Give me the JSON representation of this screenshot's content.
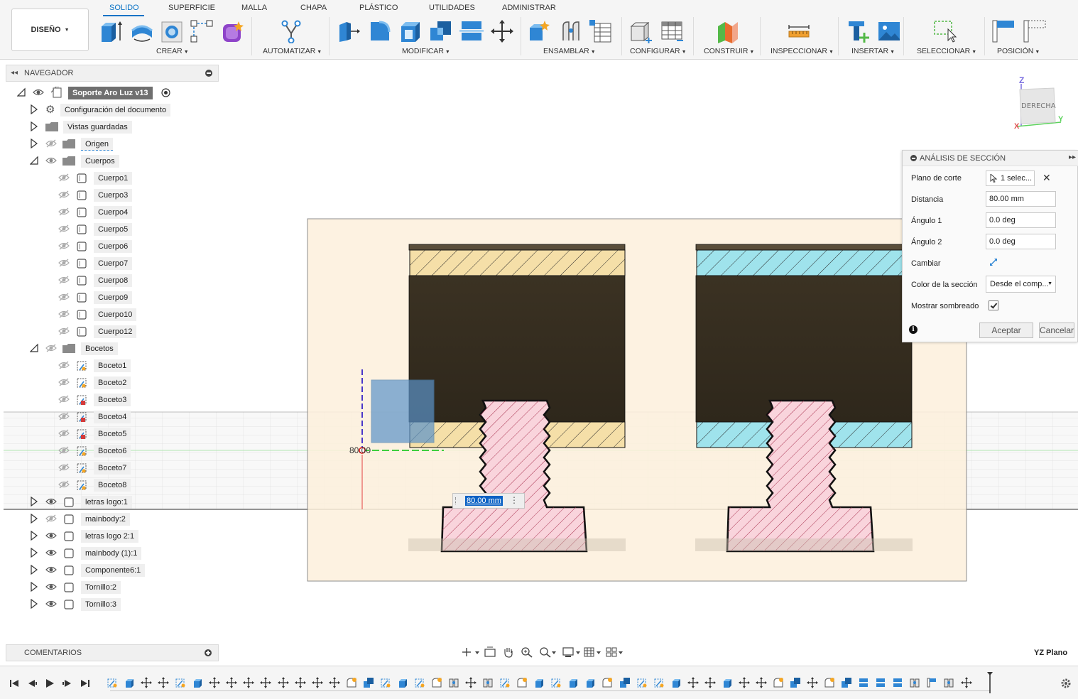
{
  "toolbar": {
    "workspace": "DISEÑO",
    "tabs": [
      "SOLIDO",
      "SUPERFICIE",
      "MALLA",
      "CHAPA",
      "PLÁSTICO",
      "UTILIDADES",
      "ADMINISTRAR"
    ],
    "active_tab": "SOLIDO",
    "groups": {
      "crear": "CREAR",
      "automatizar": "AUTOMATIZAR",
      "modificar": "MODIFICAR",
      "ensamblar": "ENSAMBLAR",
      "configurar": "CONFIGURAR",
      "construir": "CONSTRUIR",
      "inspeccionar": "INSPECCIONAR",
      "insertar": "INSERTAR",
      "seleccionar": "SELECCIONAR",
      "posicion": "POSICIÓN"
    }
  },
  "navigator": {
    "title": "NAVEGADOR",
    "root": "Soporte Aro Luz v13",
    "doc_settings": "Configuración del documento",
    "saved_views": "Vistas guardadas",
    "origin": "Origen",
    "bodies_folder": "Cuerpos",
    "bodies": [
      "Cuerpo1",
      "Cuerpo3",
      "Cuerpo4",
      "Cuerpo5",
      "Cuerpo6",
      "Cuerpo7",
      "Cuerpo8",
      "Cuerpo9",
      "Cuerpo10",
      "Cuerpo12"
    ],
    "sketches_folder": "Bocetos",
    "sketches": [
      "Boceto1",
      "Boceto2",
      "Boceto3",
      "Boceto4",
      "Boceto5",
      "Boceto6",
      "Boceto7",
      "Boceto8"
    ],
    "components": [
      "letras logo:1",
      "mainbody:2",
      "letras logo 2:1",
      "mainbody (1):1",
      "Componente6:1",
      "Tornillo:2",
      "Tornillo:3"
    ]
  },
  "comments": {
    "title": "COMENTARIOS"
  },
  "viewcube": {
    "face": "DERECHA",
    "axis_z": "Z",
    "axis_y": "Y",
    "axis_x": "X"
  },
  "viewport": {
    "dimension_label": "80.00",
    "dimension_input": "80.00 mm",
    "plane_label": "YZ Plano"
  },
  "section_panel": {
    "title": "ANÁLISIS DE SECCIÓN",
    "plane_label": "Plano de corte",
    "plane_value": "1 selec...",
    "distance_label": "Distancia",
    "distance_value": "80.00 mm",
    "angle1_label": "Ángulo 1",
    "angle1_value": "0.0 deg",
    "angle2_label": "Ángulo 2",
    "angle2_value": "0.0 deg",
    "flip_label": "Cambiar",
    "color_label": "Color de la sección",
    "color_value": "Desde el comp...",
    "shading_label": "Mostrar sombreado",
    "shading_checked": true,
    "ok": "Aceptar",
    "cancel": "Cancelar"
  },
  "colors": {
    "accent": "#0a73c6",
    "section_yellow": "#f5dfa8",
    "section_cyan": "#9fe3ec",
    "section_pink": "#f9d4dc",
    "body_dark": "#3a3122",
    "plane": "#fdf0dc"
  },
  "icons": {
    "timeline_controls": [
      "skip-start-icon",
      "step-back-icon",
      "play-icon",
      "step-forward-icon",
      "skip-end-icon"
    ],
    "settings": "gear-icon"
  }
}
